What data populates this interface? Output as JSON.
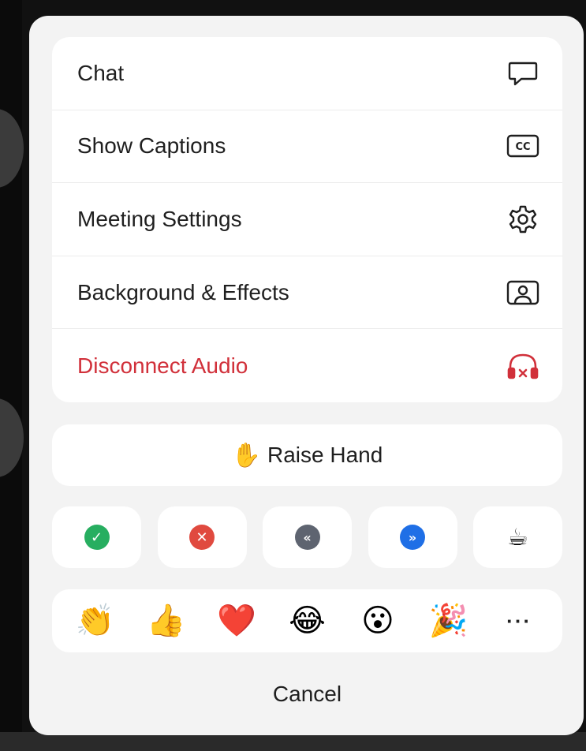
{
  "menu": {
    "items": [
      {
        "label": "Chat",
        "icon": "chat-bubble-icon"
      },
      {
        "label": "Show Captions",
        "icon": "cc-icon"
      },
      {
        "label": "Meeting Settings",
        "icon": "gear-icon"
      },
      {
        "label": "Background & Effects",
        "icon": "background-portrait-icon"
      },
      {
        "label": "Disconnect Audio",
        "icon": "headphones-disconnect-icon",
        "color": "#d1303a"
      }
    ]
  },
  "raise_hand": {
    "emoji": "✋",
    "label": "Raise Hand"
  },
  "status_buttons": [
    {
      "name": "yes-icon",
      "glyph": "✓",
      "color": "#27ae60"
    },
    {
      "name": "no-icon",
      "glyph": "✕",
      "color": "#e04a3f"
    },
    {
      "name": "slow-down-icon",
      "glyph": "«",
      "color": "#5e6470"
    },
    {
      "name": "speed-up-icon",
      "glyph": "»",
      "color": "#1f6fe6"
    },
    {
      "name": "coffee-icon",
      "glyph": "☕"
    }
  ],
  "reactions": {
    "items": [
      "👏",
      "👍",
      "❤️",
      "😂",
      "😮",
      "🎉"
    ],
    "more": "···"
  },
  "cancel_label": "Cancel",
  "colors": {
    "danger": "#d1303a",
    "sheet": "#f3f3f3",
    "card": "#ffffff"
  }
}
